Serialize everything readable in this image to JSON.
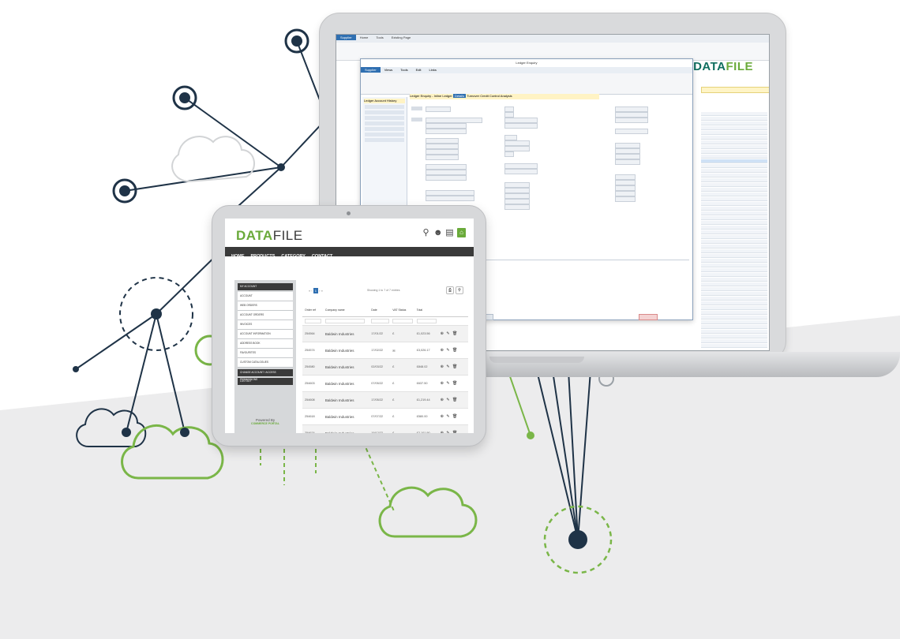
{
  "colors": {
    "brand_green": "#6aaa3a",
    "brand_dark": "#2c3e50",
    "nav_dark": "#3a3a3a",
    "accent_blue": "#2f6fb1"
  },
  "laptop_app": {
    "brand": {
      "first": "DATA",
      "second": "FILE"
    },
    "menu_tabs": [
      "Supplier",
      "Home",
      "Tools",
      "Existing Page"
    ],
    "window_title": "Ledger Enquiry",
    "window_tabs": [
      "Supplier",
      "Views",
      "Tools",
      "Edit",
      "Links"
    ],
    "record_tabs": [
      "Ledger Enquiry - Inline Ledger",
      "Details",
      "Turnover",
      "Credit Control",
      "Analysis"
    ],
    "left_panel": {
      "header": "Ledger Account History",
      "buttons": [
        "Sales Account",
        "Purchase Account",
        "Nominal Account"
      ]
    },
    "bottom_buttons": [
      "Add",
      "Edit",
      "Delete",
      "Change",
      "Close"
    ]
  },
  "tablet_app": {
    "logo": {
      "first": "DATA",
      "second": "FILE"
    },
    "header_icons": [
      "search-icon",
      "user-icon",
      "clipboard-icon",
      "cart-icon"
    ],
    "nav": [
      "HOME",
      "PRODUCTS",
      "CATEGORY",
      "CONTACT"
    ],
    "sidebar": {
      "header": "MY ACCOUNT",
      "items": [
        "ACCOUNT",
        "WEB ORDERS",
        "ACCOUNT ORDERS",
        "INVOICES",
        "ACCOUNT INFORMATION",
        "ADDRESS BOOK",
        "FAVOURITES",
        "CUSTOM CATALOGUES"
      ],
      "dark_items": [
        "CHANGE ACCOUNT / ACCESS PERMISSIONS",
        "LOG OUT"
      ],
      "powered_by": "Powered By",
      "powered_brand": "COMMERCE PORTAL"
    },
    "pager": {
      "prev": "«  ‹",
      "current": "1",
      "next": "›  »"
    },
    "showing": "Showing 1 to 7 of 7 entries",
    "table": {
      "columns": [
        "Order ref",
        "Company name",
        "Date",
        "VAT Status",
        "Total",
        ""
      ],
      "rows": [
        {
          "ref": "254564",
          "company": "Baldwin Industries",
          "date": "17/01/22",
          "status": "£",
          "total": "£1,023.56"
        },
        {
          "ref": "254574",
          "company": "Baldwin Industries",
          "date": "17/02/22",
          "status": "✉",
          "total": "£3,026.17"
        },
        {
          "ref": "254580",
          "company": "Baldwin Industries",
          "date": "02/03/22",
          "status": "£",
          "total": "£848.02"
        },
        {
          "ref": "254603",
          "company": "Baldwin Industries",
          "date": "07/05/22",
          "status": "£",
          "total": "£637.50"
        },
        {
          "ref": "254608",
          "company": "Baldwin Industries",
          "date": "17/05/22",
          "status": "£",
          "total": "£1,219.44"
        },
        {
          "ref": "254618",
          "company": "Baldwin Industries",
          "date": "07/07/22",
          "status": "£",
          "total": "£580.00"
        },
        {
          "ref": "254674",
          "company": "Baldwin Industries",
          "date": "19/12/22",
          "status": "£",
          "total": "£2,101.90"
        }
      ],
      "row_actions": "⊕ ✎ 🗑"
    }
  }
}
